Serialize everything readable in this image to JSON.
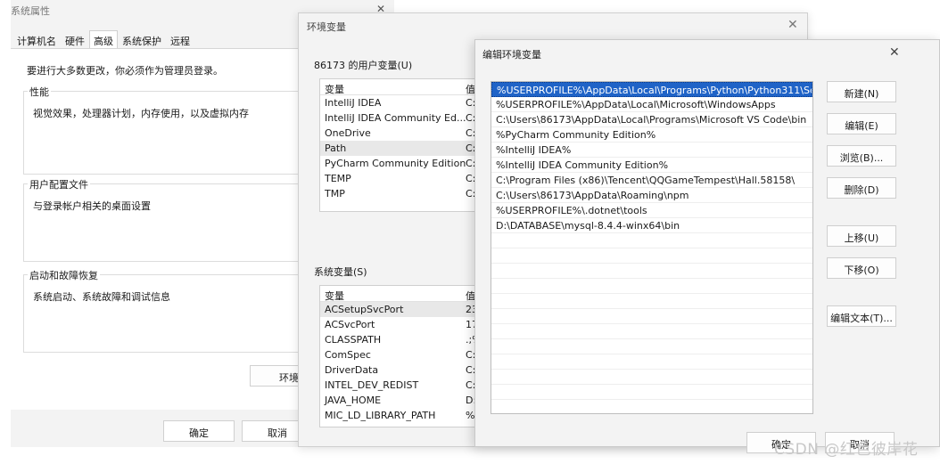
{
  "sysprops": {
    "title": "系统属性",
    "tabs": [
      "计算机名",
      "硬件",
      "高级",
      "系统保护",
      "远程"
    ],
    "notice": "要进行大多数更改，你必须作为管理员登录。",
    "groups": [
      {
        "title": "性能",
        "desc": "视觉效果，处理器计划，内存使用，以及虚拟内存"
      },
      {
        "title": "用户配置文件",
        "desc": "与登录帐户相关的桌面设置"
      },
      {
        "title": "启动和故障恢复",
        "desc": "系统启动、系统故障和调试信息"
      }
    ],
    "env_button": "环境",
    "ok": "确定",
    "cancel": "取消"
  },
  "envvars": {
    "title": "环境变量",
    "user_section": "86173 的用户变量(U)",
    "system_section": "系统变量(S)",
    "col_var": "变量",
    "col_val": "值",
    "user_vars": [
      {
        "name": "IntelliJ IDEA",
        "val": "C:\\"
      },
      {
        "name": "IntelliJ IDEA Community Ed...",
        "val": "C:\\"
      },
      {
        "name": "OneDrive",
        "val": "C:\\"
      },
      {
        "name": "Path",
        "val": "C:\\"
      },
      {
        "name": "PyCharm Community Edition",
        "val": "C:\\"
      },
      {
        "name": "TEMP",
        "val": "C:\\"
      },
      {
        "name": "TMP",
        "val": "C:\\"
      }
    ],
    "system_vars": [
      {
        "name": "ACSetupSvcPort",
        "val": "23"
      },
      {
        "name": "ACSvcPort",
        "val": "17"
      },
      {
        "name": "CLASSPATH",
        "val": ".;%"
      },
      {
        "name": "ComSpec",
        "val": "C:\\"
      },
      {
        "name": "DriverData",
        "val": "C:\\"
      },
      {
        "name": "INTEL_DEV_REDIST",
        "val": "C:\\"
      },
      {
        "name": "JAVA_HOME",
        "val": "D:\\"
      },
      {
        "name": "MIC_LD_LIBRARY_PATH",
        "val": "%"
      }
    ]
  },
  "editenv": {
    "title": "编辑环境变量",
    "paths": [
      "%USERPROFILE%\\AppData\\Local\\Programs\\Python\\Python311\\Sc...",
      "%USERPROFILE%\\AppData\\Local\\Microsoft\\WindowsApps",
      "C:\\Users\\86173\\AppData\\Local\\Programs\\Microsoft VS Code\\bin",
      "%PyCharm Community Edition%",
      "%IntelliJ IDEA%",
      "%IntelliJ IDEA Community Edition%",
      "C:\\Program Files (x86)\\Tencent\\QQGameTempest\\Hall.58158\\",
      "C:\\Users\\86173\\AppData\\Roaming\\npm",
      "%USERPROFILE%\\.dotnet\\tools",
      "D:\\DATABASE\\mysql-8.4.4-winx64\\bin",
      "",
      "",
      "",
      "",
      "",
      "",
      "",
      "",
      "",
      "",
      ""
    ],
    "buttons": {
      "new": "新建(N)",
      "edit": "编辑(E)",
      "browse": "浏览(B)...",
      "delete": "删除(D)",
      "up": "上移(U)",
      "down": "下移(O)",
      "edit_text": "编辑文本(T)..."
    },
    "ok": "确定",
    "cancel": "取消"
  },
  "watermark": "CSDN @红色彼岸花"
}
